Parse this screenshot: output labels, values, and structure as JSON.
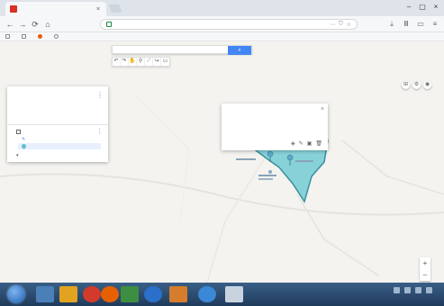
{
  "browser": {
    "tab_title": "",
    "url": "",
    "zoom": "",
    "bookmarks": [
      {
        "label": ""
      },
      {
        "label": ""
      },
      {
        "label": ""
      },
      {
        "label": ""
      }
    ]
  },
  "map": {
    "search_placeholder": "",
    "panel": {
      "title": "",
      "subtitle": "",
      "link": "",
      "actions": [
        "",
        "",
        ""
      ],
      "layer_name": "",
      "style_label": "",
      "item_label": "",
      "base_map": ""
    },
    "info_card": {
      "title": "",
      "body": "",
      "footer": ""
    },
    "attribution": "",
    "copyright": ""
  },
  "taskbar": {
    "time": "",
    "date": ""
  },
  "colors": {
    "polygon_fill": "#72cbd3",
    "polygon_stroke": "#3a8fa0",
    "map_bg": "#f4f3f0",
    "accent": "#4285f4",
    "taskbar": "#2a4a70"
  }
}
